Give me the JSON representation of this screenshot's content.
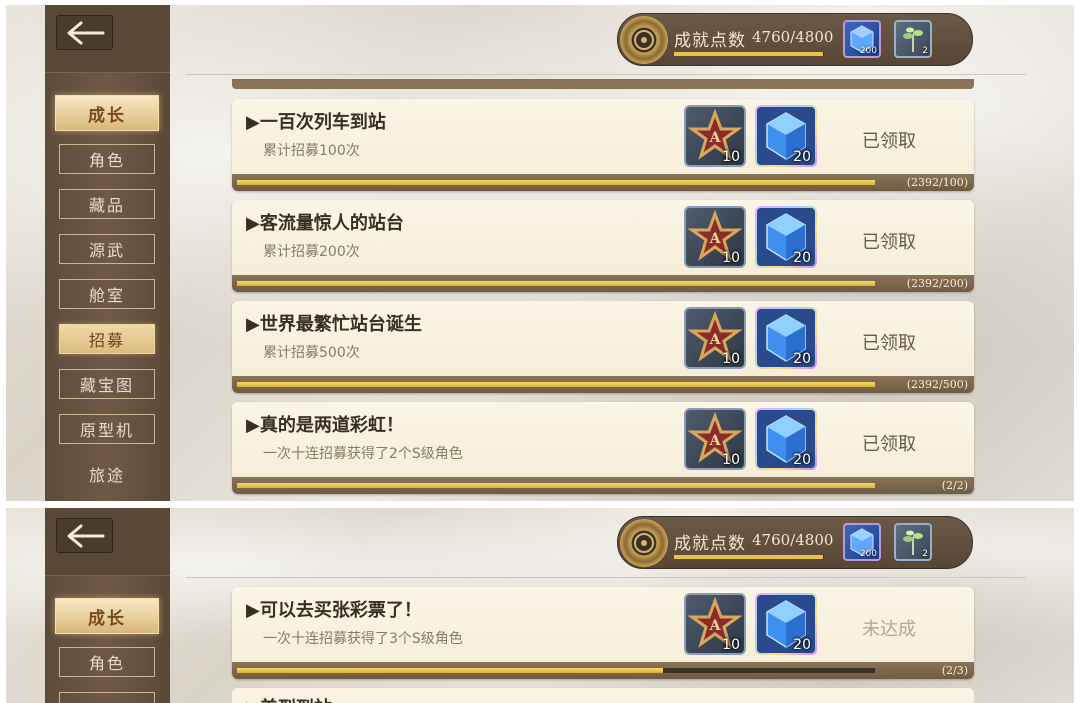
{
  "nav": {
    "items": [
      "成长",
      "角色",
      "藏品",
      "源武",
      "舱室",
      "招募",
      "藏宝图",
      "原型机",
      "旅途"
    ]
  },
  "points": {
    "label": "成就点数",
    "value": "4760/4800",
    "progress": 0.99,
    "rewards": [
      {
        "icon": "blue-crystal-icon",
        "count": "200"
      },
      {
        "icon": "plant-sprig-icon",
        "count": "2"
      }
    ]
  },
  "screen1": {
    "cards": [
      {
        "title": "▶一百次列车到站",
        "desc": "累计招募100次",
        "rewards": [
          "10",
          "20"
        ],
        "status": "已领取",
        "progress_text": "(2392/100)",
        "progress": 1.0
      },
      {
        "title": "▶客流量惊人的站台",
        "desc": "累计招募200次",
        "rewards": [
          "10",
          "20"
        ],
        "status": "已领取",
        "progress_text": "(2392/200)",
        "progress": 1.0
      },
      {
        "title": "▶世界最繁忙站台诞生",
        "desc": "累计招募500次",
        "rewards": [
          "10",
          "20"
        ],
        "status": "已领取",
        "progress_text": "(2392/500)",
        "progress": 1.0
      },
      {
        "title": "▶真的是两道彩虹！",
        "desc": "一次十连招募获得了2个S级角色",
        "rewards": [
          "10",
          "20"
        ],
        "status": "已领取",
        "progress_text": "(2/2)",
        "progress": 1.0
      }
    ]
  },
  "screen2": {
    "cards": [
      {
        "title": "▶可以去买张彩票了！",
        "desc": "一次十连招募获得了3个S级角色",
        "rewards": [
          "10",
          "20"
        ],
        "status": "未达成",
        "progress_text": "(2/3)",
        "progress": 0.667
      }
    ],
    "next_title": "▶美到到站"
  },
  "colors": {
    "accent_gold": "#e6c24a",
    "sidebar": "#5d4b3a",
    "card_bg": "#faf5e6"
  }
}
